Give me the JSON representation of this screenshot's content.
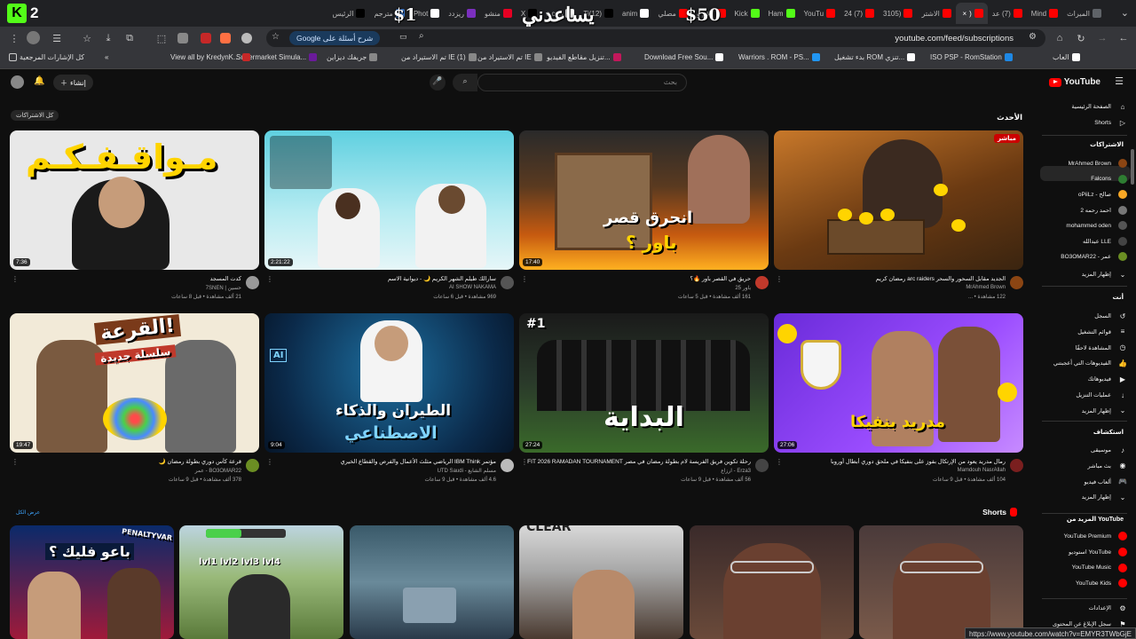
{
  "browser": {
    "tabs": [
      {
        "label": "الميراث",
        "fav": "#5f6368"
      },
      {
        "label": "Mind",
        "fav": "#ff0000"
      },
      {
        "label": "(7) عد",
        "fav": "#ff0000"
      },
      {
        "label": "(",
        "fav": "#ff0000",
        "active": true
      },
      {
        "label": "الاشتر",
        "fav": "#ff0000"
      },
      {
        "label": "(3105",
        "fav": "#ff0000"
      },
      {
        "label": "(7) 24",
        "fav": "#ff0000"
      },
      {
        "label": "YouTu",
        "fav": "#ff0000"
      },
      {
        "label": "Ham",
        "fav": "#53fc18"
      },
      {
        "label": "Kick",
        "fav": "#53fc18"
      },
      {
        "label": "كلام و",
        "fav": "#ff0000"
      },
      {
        "label": "مصلي",
        "fav": "#ff0000"
      },
      {
        "label": "anim",
        "fav": "#ffffff"
      },
      {
        "label": "(12)Ti",
        "fav": "#000000"
      },
      {
        "label": "c.con",
        "fav": "#ffffff"
      },
      {
        "label": "X",
        "fav": "#000000"
      },
      {
        "label": "منشو",
        "fav": "#e60023"
      },
      {
        "label": "ريزدد",
        "fav": "#7b2fbe"
      },
      {
        "label": "Phot",
        "fav": "#ffffff"
      },
      {
        "label": "مترجم",
        "fav": "#3a7bd5"
      },
      {
        "label": "الرئيس",
        "fav": "#000000"
      }
    ],
    "kick_badge_letter": "K",
    "kick_badge_number": "2",
    "overlay": {
      "left_amount": "$1",
      "center_text": "يساعدني",
      "right_amount": "$50"
    },
    "url": "youtube.com/feed/subscriptions",
    "google_pill": "Google شرح أسئلة على",
    "bookmarks": [
      {
        "label": "العاب",
        "ic": "#ffffff"
      },
      {
        "label": "ISO PSP - RomStation",
        "ic": "#1e88e5"
      },
      {
        "label": "بدء تشغيل ROM تنزي...",
        "ic": "#ffffff"
      },
      {
        "label": "Warriors . ROM - PS...",
        "ic": "#2196f3"
      },
      {
        "label": "Download Free Sou...",
        "ic": "#ffffff"
      },
      {
        "label": "تنزيل مقاطع الفيديو...",
        "ic": "#c2185b"
      },
      {
        "label": "تم الاستيراد من IE",
        "ic": "#888"
      },
      {
        "label": "تم الاستيراد من IE (1)",
        "ic": "#888"
      },
      {
        "label": "جريفك ديزاين",
        "ic": "#888"
      },
      {
        "label": "Supermarket Simula...",
        "ic": "#6a1b9a"
      },
      {
        "label": "View all by KredynK...",
        "ic": "#c62828"
      }
    ],
    "all_bookmarks": "كل الإشارات المرجعية",
    "status_url": "https://www.youtube.com/watch?v=EMYR3TWbGjE"
  },
  "youtube": {
    "logo": "YouTube",
    "search_placeholder": "بحث",
    "create_label": "إنشاء",
    "all_subs_chip": "كل الاشتراكات",
    "latest_heading": "الأحدث",
    "shorts_heading": "Shorts",
    "shorts_more": "عرض الكل",
    "videos": [
      {
        "title": "الجديد مقابل السحور والسحر arc raiders رمضان كريم",
        "channel": "MrAhmed Brown",
        "stats": "122 مشاهدة • ...",
        "duration": "",
        "live": "مباشر",
        "av": "#8b4513"
      },
      {
        "title": "حريق في القصر باور 🔥؟",
        "channel": "باور 25",
        "stats": "161 ألف مشاهدة • قبل 5 ساعات",
        "duration": "17:40",
        "av": "#c0392b"
      },
      {
        "title": "سارالك طيلم الشهر الكريم 🌙 - ديوانية الاسم",
        "channel": "AI SHOW NAKAMA",
        "stats": "969 مشاهدة • قبل 6 ساعات",
        "duration": "2:21:22",
        "av": "#555"
      },
      {
        "title": "كدت المسجد",
        "channel": "حسين | 7SNEN",
        "stats": "21 ألف مشاهدة • قبل 8 ساعات",
        "duration": "7:36",
        "av": "#999"
      },
      {
        "title": "رمال مدريد يعود من الإرتكال بفوز على بنفيكا في ملحق دوري أبطال أوروبا",
        "channel": "Mamdouh NasrAllah",
        "stats": "104 ألف مشاهدة • قبل 9 ساعات",
        "duration": "27:06",
        "av": "#7a1f1f"
      },
      {
        "title": "رحلة تكوين فريق الفريسة لام بطولة رمضان في مصر EA FOOTFIT 2026 RAMADAN TOURNAMENT",
        "channel": "Erza3 - ارزاع",
        "stats": "56 ألف مشاهدة • قبل 9 ساعات",
        "duration": "27:24",
        "av": "#444"
      },
      {
        "title": "مؤتمر IBM Think الرياضي مثلث الأعمال والفرص والقطاع الخيري",
        "channel": "مسلم الشايع - UTD Saudi",
        "stats": "4.6 ألف مشاهدة • قبل 9 ساعات",
        "duration": "9:04",
        "av": "#bbb"
      },
      {
        "title": "قرعة كأس دوري بطولة رمضان 🌙",
        "channel": "BO3OMAR22 - عمر",
        "stats": "378 ألف مشاهدة • قبل 9 ساعات",
        "duration": "19:47",
        "av": "#6b8e23"
      }
    ],
    "thumb_texts": {
      "t1": "مـواقـفـكـم",
      "t2": "انحرق قصر",
      "t3": "باور ؟",
      "t4": "القرعة!",
      "t5": "سلسلة جديدة",
      "t6": "الطيران والذكاء",
      "t7": "الاصطناعي",
      "t8": "البداية",
      "t9": "#1",
      "t10": "مدريد بنفيكا",
      "t11": "باعو فليك ؟",
      "t12": "PENALTYVAR",
      "t13": "lvl1 lvl2 lvl3 lvl4",
      "t14": "CLEAR",
      "t15": "AI"
    },
    "sidebar": {
      "home": "الصفحة الرئيسية",
      "shorts": "Shorts",
      "subs_heading": "الاشتراكات",
      "subs": [
        {
          "label": "MrAhmed Brown",
          "c": "#8b4513"
        },
        {
          "label": "Falcons",
          "c": "#2e7d32"
        },
        {
          "label": "oPiiLz - صالح",
          "c": "#f9a825"
        },
        {
          "label": "احمد رحمه 2",
          "c": "#777"
        },
        {
          "label": "mohammed oden",
          "c": "#555"
        },
        {
          "label": "عبدالله LLE",
          "c": "#444"
        },
        {
          "label": "BO3OMAR22 - عمر",
          "c": "#6b8e23"
        }
      ],
      "show_more": "إظهار المزيد",
      "you_heading": "أنت",
      "you": [
        {
          "label": "السجل",
          "ic": "↺"
        },
        {
          "label": "قوائم التشغيل",
          "ic": "≡"
        },
        {
          "label": "المشاهدة لاحقًا",
          "ic": "◷"
        },
        {
          "label": "الفيديوهات التي أعجبتني",
          "ic": "👍"
        },
        {
          "label": "فيديوهاتك",
          "ic": "▶"
        },
        {
          "label": "عمليات التنزيل",
          "ic": "↓"
        },
        {
          "label": "إظهار المزيد",
          "ic": "⌄"
        }
      ],
      "explore_heading": "استكشاف",
      "explore": [
        {
          "label": "موسيقى",
          "ic": "♪"
        },
        {
          "label": "بث مباشر",
          "ic": "◉"
        },
        {
          "label": "ألعاب فيديو",
          "ic": "🎮"
        },
        {
          "label": "إظهار المزيد",
          "ic": "⌄"
        }
      ],
      "more_heading": "المزيد من YouTube",
      "more": [
        {
          "label": "YouTube Premium",
          "c": "#ff0000"
        },
        {
          "label": "استوديو YouTube",
          "c": "#ff0000"
        },
        {
          "label": "YouTube Music",
          "c": "#ff0000"
        },
        {
          "label": "YouTube Kids",
          "c": "#ff0000"
        }
      ],
      "settings": "الإعدادات",
      "report": "سجل الإبلاغ عن المحتوى"
    }
  }
}
